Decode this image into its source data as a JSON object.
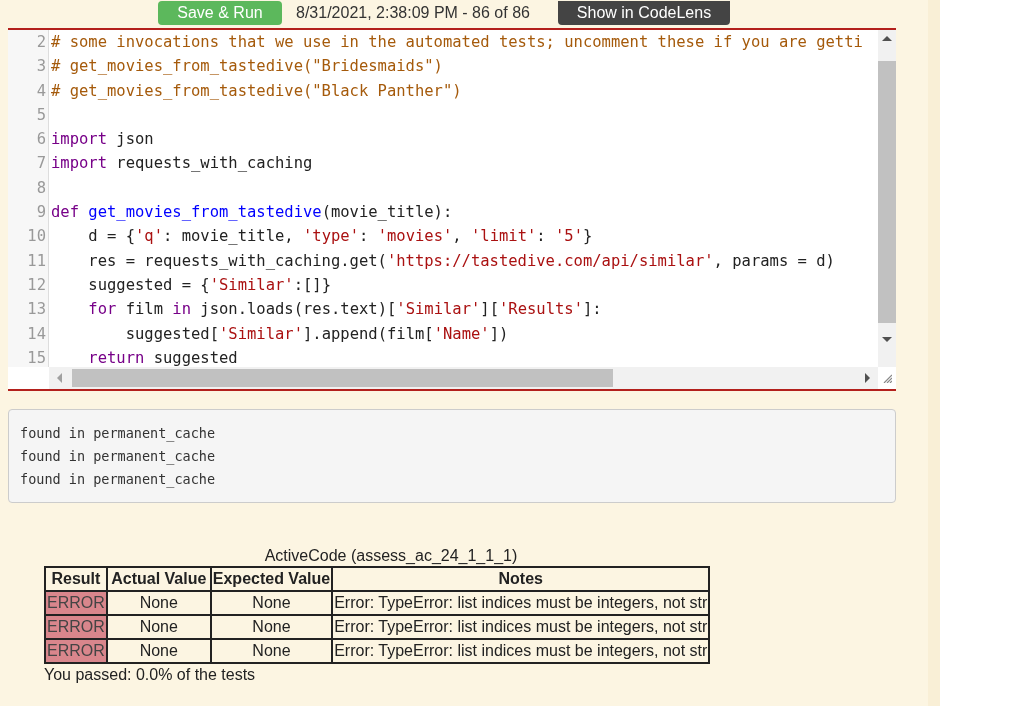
{
  "toolbar": {
    "run_button": "Save & Run",
    "history": "8/31/2021, 2:38:09 PM - 86 of 86",
    "codelens_button": "Show in CodeLens"
  },
  "editor": {
    "lines": [
      {
        "number": "2",
        "tokens": [
          {
            "kind": "comment",
            "text": "# some invocations that we use in the automated tests; uncomment these if you are getti"
          }
        ]
      },
      {
        "number": "3",
        "tokens": [
          {
            "kind": "comment",
            "text": "# get_movies_from_tastedive(\"Bridesmaids\")"
          }
        ]
      },
      {
        "number": "4",
        "tokens": [
          {
            "kind": "comment",
            "text": "# get_movies_from_tastedive(\"Black Panther\")"
          }
        ]
      },
      {
        "number": "5"
      },
      {
        "number": "6",
        "tokens": [
          {
            "kind": "keyword",
            "text": "import"
          },
          {
            "kind": "plain",
            "text": " json"
          }
        ]
      },
      {
        "number": "7",
        "tokens": [
          {
            "kind": "keyword",
            "text": "import"
          },
          {
            "kind": "plain",
            "text": " requests_with_caching"
          }
        ]
      },
      {
        "number": "8"
      },
      {
        "number": "9",
        "tokens": [
          {
            "kind": "keyword",
            "text": "def "
          },
          {
            "kind": "function",
            "text": "get_movies_from_tastedive"
          },
          {
            "kind": "plain",
            "text": "(movie_title):"
          }
        ]
      },
      {
        "number": "10",
        "tokens": [
          {
            "kind": "plain",
            "text": "    d = {"
          },
          {
            "kind": "string",
            "text": "'q'"
          },
          {
            "kind": "plain",
            "text": ": movie_title, "
          },
          {
            "kind": "string",
            "text": "'type'"
          },
          {
            "kind": "plain",
            "text": ": "
          },
          {
            "kind": "string",
            "text": "'movies'"
          },
          {
            "kind": "plain",
            "text": ", "
          },
          {
            "kind": "string",
            "text": "'limit'"
          },
          {
            "kind": "plain",
            "text": ": "
          },
          {
            "kind": "string",
            "text": "'5'"
          },
          {
            "kind": "plain",
            "text": "}"
          }
        ]
      },
      {
        "number": "11",
        "tokens": [
          {
            "kind": "plain",
            "text": "    res = requests_with_caching.get("
          },
          {
            "kind": "string",
            "text": "'https://tastedive.com/api/similar'"
          },
          {
            "kind": "plain",
            "text": ", params = d)"
          }
        ]
      },
      {
        "number": "12",
        "tokens": [
          {
            "kind": "plain",
            "text": "    suggested = {"
          },
          {
            "kind": "string",
            "text": "'Similar'"
          },
          {
            "kind": "plain",
            "text": ":[]}"
          }
        ]
      },
      {
        "number": "13",
        "tokens": [
          {
            "kind": "keyword",
            "text": "    for"
          },
          {
            "kind": "plain",
            "text": " film "
          },
          {
            "kind": "keyword",
            "text": "in"
          },
          {
            "kind": "plain",
            "text": " json.loads(res.text)["
          },
          {
            "kind": "string",
            "text": "'Similar'"
          },
          {
            "kind": "plain",
            "text": "]["
          },
          {
            "kind": "string",
            "text": "'Results'"
          },
          {
            "kind": "plain",
            "text": "]:"
          }
        ]
      },
      {
        "number": "14",
        "tokens": [
          {
            "kind": "plain",
            "text": "        suggested["
          },
          {
            "kind": "string",
            "text": "'Similar'"
          },
          {
            "kind": "plain",
            "text": "].append(film["
          },
          {
            "kind": "string",
            "text": "'Name'"
          },
          {
            "kind": "plain",
            "text": "])"
          }
        ]
      },
      {
        "number": "15",
        "tokens": [
          {
            "kind": "keyword",
            "text": "    return"
          },
          {
            "kind": "plain",
            "text": " suggested"
          }
        ]
      }
    ]
  },
  "output": [
    "found in permanent_cache",
    "found in permanent_cache",
    "found in permanent_cache"
  ],
  "results": {
    "caption": "ActiveCode (assess_ac_24_1_1_1)",
    "columns": [
      "Result",
      "Actual Value",
      "Expected Value",
      "Notes"
    ],
    "rows": [
      {
        "result": "ERROR",
        "passed": false,
        "actual": "None",
        "expected": "None",
        "notes": "Error: TypeError: list indices must be integers, not str"
      },
      {
        "result": "ERROR",
        "passed": false,
        "actual": "None",
        "expected": "None",
        "notes": "Error: TypeError: list indices must be integers, not str"
      },
      {
        "result": "ERROR",
        "passed": false,
        "actual": "None",
        "expected": "None",
        "notes": "Error: TypeError: list indices must be integers, not str"
      }
    ],
    "summary": "You passed: 0.0% of the tests"
  }
}
